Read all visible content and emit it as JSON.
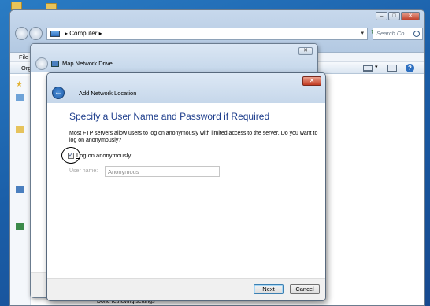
{
  "explorer": {
    "address_path": "Computer",
    "search_placeholder": "Search Co...",
    "menu_file": "File",
    "organize_label": "Org",
    "status_text": "Done retrieving settings",
    "caption_buttons": {
      "minimize": "–",
      "maximize": "□",
      "close": "✕"
    }
  },
  "map_network_drive": {
    "title": "Map Network Drive",
    "close_label": "✕"
  },
  "wizard": {
    "title": "Add Network Location",
    "close_label": "✕",
    "heading": "Specify a User Name and Password if Required",
    "description": "Most FTP servers allow users to log on anonymously with limited access to the server.  Do you want to log on anonymously?",
    "checkbox_prefix": "L",
    "checkbox_rest": "og on anonymously",
    "checkbox_checked": true,
    "username_label": "User name:",
    "username_value": "Anonymous",
    "next_label": "Next",
    "cancel_label": "Cancel"
  },
  "colors": {
    "heading_blue": "#1e3e8c",
    "desktop_blue": "#1a5ea8",
    "close_red": "#c23b22"
  }
}
